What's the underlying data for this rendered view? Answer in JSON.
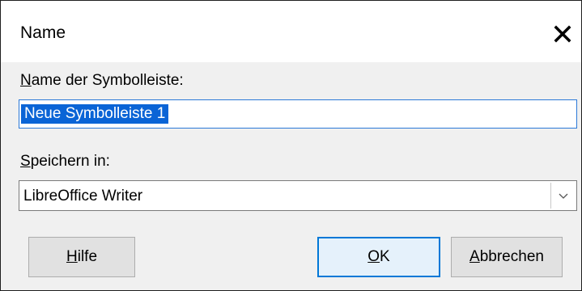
{
  "dialog": {
    "title": "Name",
    "close_icon": "close-icon"
  },
  "name_field": {
    "label_accel": "N",
    "label_rest": "ame der Symbolleiste:",
    "value": "Neue Symbolleiste 1"
  },
  "save_in": {
    "label_accel": "S",
    "label_rest": "peichern in:",
    "selected": "LibreOffice Writer",
    "dropdown_icon": "chevron-down-icon"
  },
  "buttons": {
    "help_accel": "H",
    "help_rest": "ilfe",
    "ok_accel": "O",
    "ok_rest": "K",
    "cancel_accel": "A",
    "cancel_rest": "bbrechen"
  },
  "colors": {
    "selection": "#0a64d6",
    "focus_border": "#0078d7",
    "dialog_bg": "#f0f0f0"
  }
}
